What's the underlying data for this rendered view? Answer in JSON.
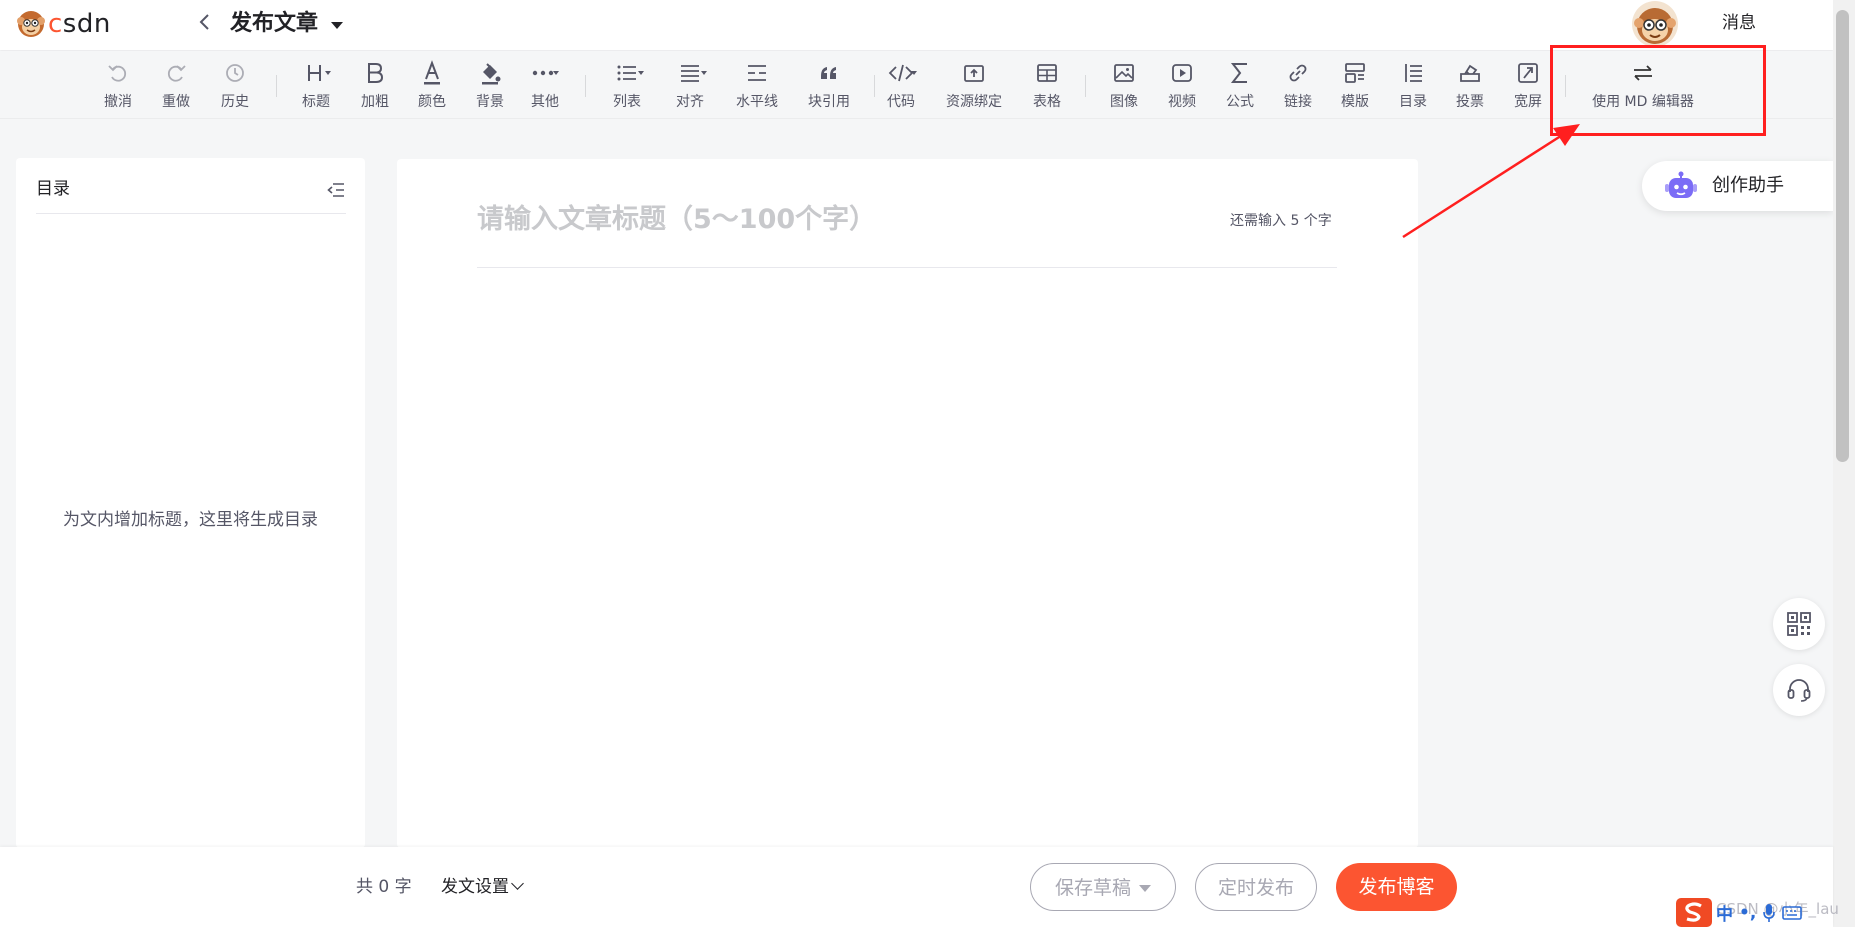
{
  "header": {
    "logo_text": "CSDN",
    "page_title": "发布文章",
    "messages_label": "消息"
  },
  "toolbar": {
    "undo": "撤消",
    "redo": "重做",
    "history": "历史",
    "heading": "标题",
    "bold": "加粗",
    "color": "颜色",
    "background": "背景",
    "other": "其他",
    "list": "列表",
    "align": "对齐",
    "hr": "水平线",
    "quote": "块引用",
    "code": "代码",
    "resource": "资源绑定",
    "table": "表格",
    "image": "图像",
    "video": "视频",
    "formula": "公式",
    "link": "链接",
    "template": "模版",
    "toc": "目录",
    "vote": "投票",
    "widescreen": "宽屏",
    "md_editor": "使用 MD 编辑器"
  },
  "toc": {
    "title": "目录",
    "empty_hint": "为文内增加标题，这里将生成目录"
  },
  "editor": {
    "title_value": "",
    "title_placeholder": "请输入文章标题（5～100个字）",
    "remaining": "还需输入 5 个字"
  },
  "assistant": {
    "label": "创作助手"
  },
  "footer": {
    "word_count": "共 0 字",
    "publish_settings": "发文设置",
    "save_draft": "保存草稿",
    "schedule": "定时发布",
    "publish": "发布博客"
  },
  "watermark": "CSDN @小年_lau",
  "ime": {
    "lang": "中",
    "punct": "•,"
  },
  "colors": {
    "brand": "#fc5531",
    "annotation": "#ff1f1f",
    "assistant_icon": "#7b6cf6"
  }
}
